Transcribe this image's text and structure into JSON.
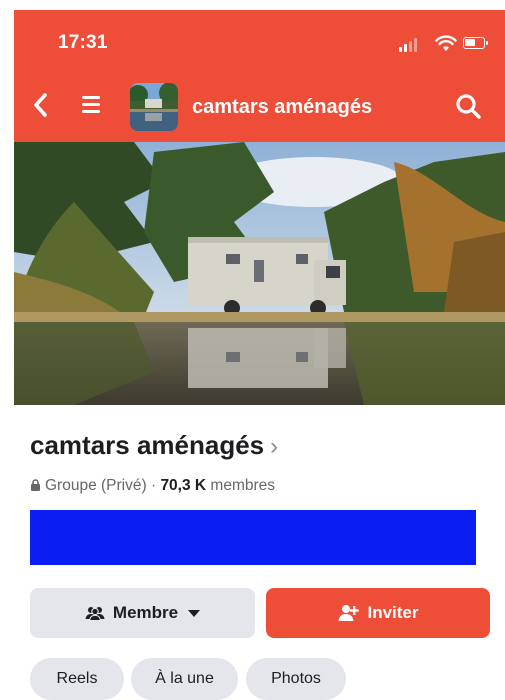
{
  "status_bar": {
    "time": "17:31"
  },
  "header": {
    "title": "camtars aménagés"
  },
  "group": {
    "name": "camtars aménagés",
    "name_chevron": "›",
    "privacy": "Groupe (Privé)",
    "separator": " · ",
    "member_count": "70,3 K",
    "member_label": " membres"
  },
  "actions": {
    "member_label": "Membre",
    "invite_label": "Inviter"
  },
  "tabs": [
    {
      "label": "Reels"
    },
    {
      "label": "À la une"
    },
    {
      "label": "Photos"
    }
  ],
  "colors": {
    "brand_red": "#EE4D38",
    "redaction_blue": "#0A1DF2",
    "chip_gray": "#E4E6EB"
  },
  "icons": [
    "back-chevron-icon",
    "hamburger-menu-icon",
    "search-icon",
    "lock-icon",
    "members-icon",
    "add-person-icon",
    "caret-down-icon",
    "wifi-icon",
    "signal-icon",
    "battery-icon"
  ]
}
